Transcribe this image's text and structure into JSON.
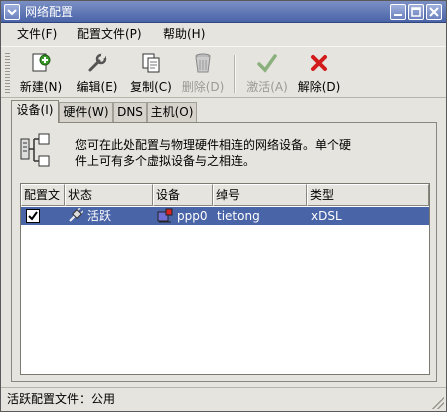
{
  "window": {
    "title": "网络配置",
    "controls": [
      "chevron-down-icon",
      "minimize-icon",
      "maximize-icon",
      "close-icon"
    ]
  },
  "menubar": {
    "items": [
      "文件(F)",
      "配置文件(P)",
      "帮助(H)"
    ]
  },
  "toolbar": {
    "new": "新建(N)",
    "edit": "编辑(E)",
    "copy": "复制(C)",
    "delete": "删除(D)",
    "activate": "激活(A)",
    "deactivate": "解除(D)"
  },
  "tabs": [
    "设备(I)",
    "硬件(W)",
    "DNS",
    "主机(O)"
  ],
  "info": {
    "text_line1": "您可在此处配置与物理硬件相连的网络设备。单个硬",
    "text_line2": "件上可有多个虚拟设备与之相连。"
  },
  "table": {
    "columns": [
      "配置文",
      "状态",
      "设备",
      "绰号",
      "类型"
    ],
    "rows": [
      {
        "profile_checked": true,
        "status": "活跃",
        "device": "ppp0",
        "nickname": "tietong",
        "type": "xDSL"
      }
    ]
  },
  "statusbar": {
    "text": "活跃配置文件：公用"
  },
  "colors": {
    "titlebar": "#4a64a8",
    "selection": "#4a64a8",
    "window_bg": "#e6e4de"
  }
}
